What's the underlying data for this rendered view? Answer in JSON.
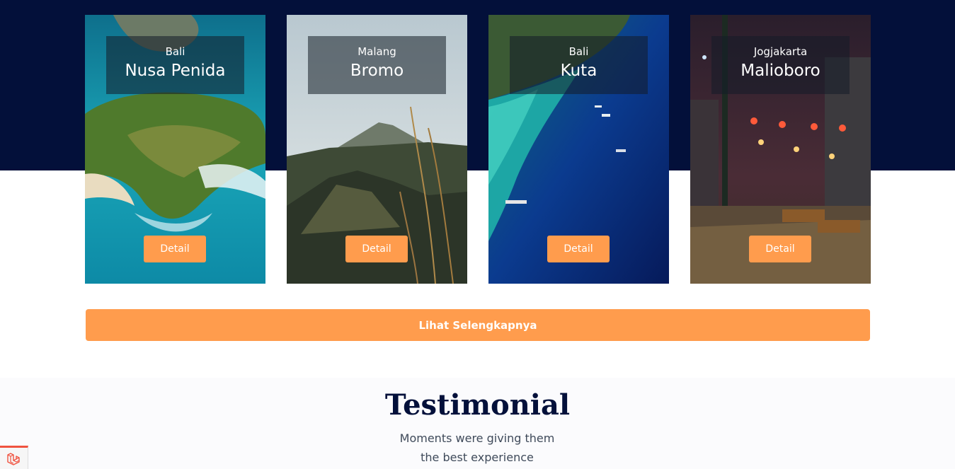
{
  "destinations": [
    {
      "region": "Bali",
      "name": "Nusa Penida",
      "button": "Detail"
    },
    {
      "region": "Malang",
      "name": "Bromo",
      "button": "Detail"
    },
    {
      "region": "Bali",
      "name": "Kuta",
      "button": "Detail"
    },
    {
      "region": "Jogjakarta",
      "name": "Malioboro",
      "button": "Detail"
    }
  ],
  "more_button": "Lihat Selengkapnya",
  "testimonial": {
    "title": "Testimonial",
    "subtitle_line1": "Moments were giving them",
    "subtitle_line2": "the best experience"
  },
  "colors": {
    "navy": "#03103a",
    "accent": "#ff9c4d",
    "debug_red": "#f05340"
  },
  "icons": {
    "debug_badge": "laravel-logo-icon"
  }
}
